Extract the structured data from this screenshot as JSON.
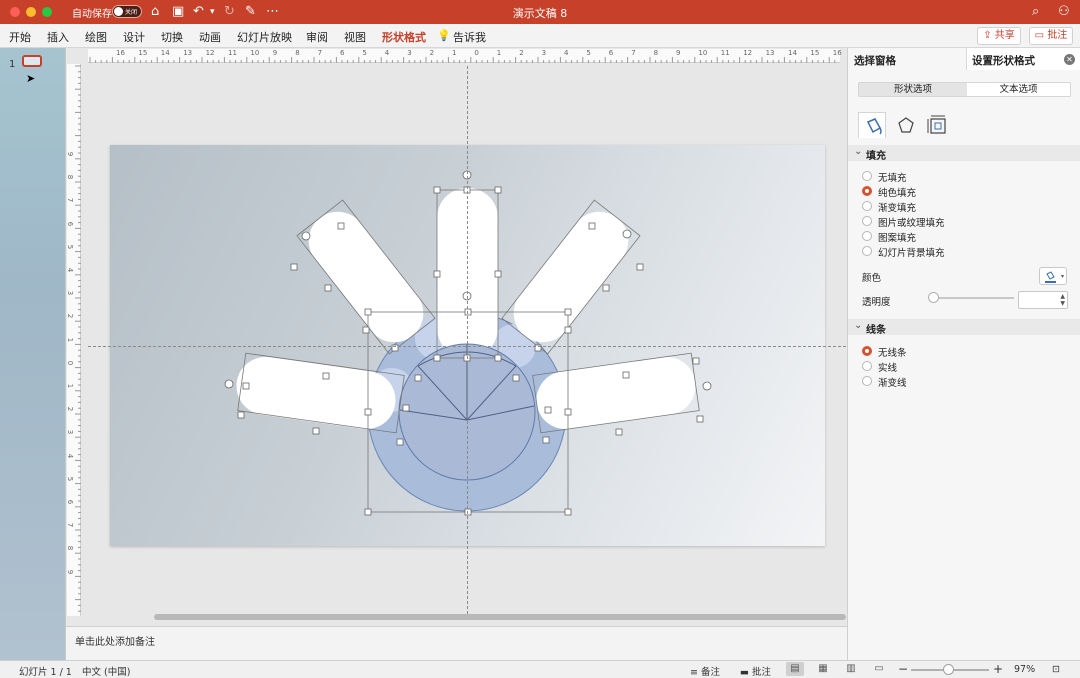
{
  "window": {
    "title": "演示文稿 8",
    "autosave_label": "自动保存",
    "autosave_state": "关闭"
  },
  "ribbon": {
    "tabs": [
      "开始",
      "插入",
      "绘图",
      "设计",
      "切换",
      "动画",
      "幻灯片放映",
      "审阅",
      "视图",
      "形状格式",
      "告诉我"
    ],
    "active_tab": "形状格式",
    "share_label": "共享",
    "comment_label": "批注"
  },
  "thumbnails": {
    "slide_number": "1"
  },
  "rulers": {
    "horizontal": [
      "16",
      "15",
      "14",
      "13",
      "12",
      "11",
      "10",
      "9",
      "8",
      "7",
      "6",
      "5",
      "4",
      "3",
      "2",
      "1",
      "0",
      "1",
      "2",
      "3",
      "4",
      "5",
      "6",
      "7",
      "8",
      "9",
      "10",
      "11",
      "12",
      "13",
      "14",
      "15",
      "16"
    ],
    "vertical": [
      "9",
      "8",
      "7",
      "6",
      "5",
      "4",
      "3",
      "2",
      "1",
      "0",
      "1",
      "2",
      "3",
      "4",
      "5",
      "6",
      "7",
      "8",
      "9"
    ]
  },
  "notes": {
    "placeholder": "单击此处添加备注"
  },
  "format_pane": {
    "tab_selection": "选择窗格",
    "tab_format": "设置形状格式",
    "segment_shape": "形状选项",
    "segment_text": "文本选项",
    "fill_section": "填充",
    "fill_options": [
      "无填充",
      "纯色填充",
      "渐变填充",
      "图片或纹理填充",
      "图案填充",
      "幻灯片背景填充"
    ],
    "fill_selected": "纯色填充",
    "color_label": "颜色",
    "transparency_label": "透明度",
    "line_section": "线条",
    "line_options": [
      "无线条",
      "实线",
      "渐变线"
    ],
    "line_selected": "无线条"
  },
  "status_bar": {
    "slide_info": "幻灯片 1 / 1",
    "language": "中文 (中国)",
    "notes_label": "备注",
    "comments_label": "批注",
    "zoom": "97%"
  },
  "colors": {
    "accent": "#c6402a",
    "circle_fill": "#a9bddb",
    "circle_stroke": "#6a86b6",
    "radio_on": "#d4532f"
  }
}
